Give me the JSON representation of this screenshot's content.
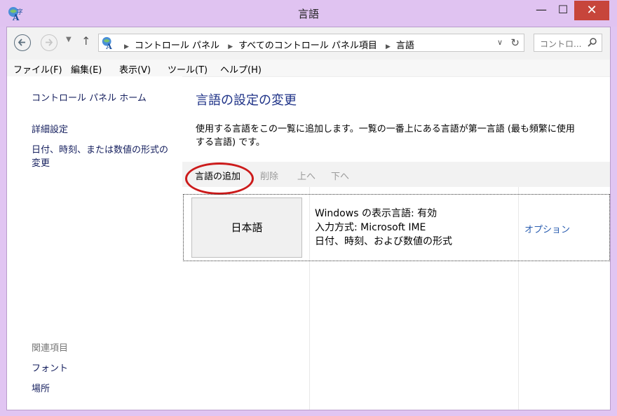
{
  "window": {
    "title": "言語"
  },
  "address": {
    "crumbs": [
      "コントロール パネル",
      "すべてのコントロール パネル項目",
      "言語"
    ],
    "search_placeholder": "コントロ..."
  },
  "menu": [
    "ファイル(F)",
    "編集(E)",
    "表示(V)",
    "ツール(T)",
    "ヘルプ(H)"
  ],
  "sidebar": {
    "home": "コントロール パネル ホーム",
    "advanced": "詳細設定",
    "datetime_line1": "日付、時刻、または数値の形式の",
    "datetime_line2": "変更",
    "related_header": "関連項目",
    "fonts": "フォント",
    "location": "場所"
  },
  "main": {
    "heading": "言語の設定の変更",
    "description_line1": "使用する言語をこの一覧に追加します。一覧の一番上にある言語が第一言語 (最も頻繁に使用",
    "description_line2": "する言語) です。",
    "toolbar": {
      "add": "言語の追加",
      "remove": "削除",
      "up": "上へ",
      "down": "下へ"
    },
    "languages": [
      {
        "name": "日本語",
        "display_language": "Windows の表示言語: 有効",
        "input_method": "入力方式: Microsoft IME",
        "format": "日付、時刻、および数値の形式",
        "options": "オプション"
      }
    ]
  },
  "colors": {
    "title_bar": "#e0c3f1",
    "close_button": "#c7453b",
    "link": "#151f5e",
    "heading": "#1e3287",
    "highlight_circle": "#cc1b1b"
  }
}
